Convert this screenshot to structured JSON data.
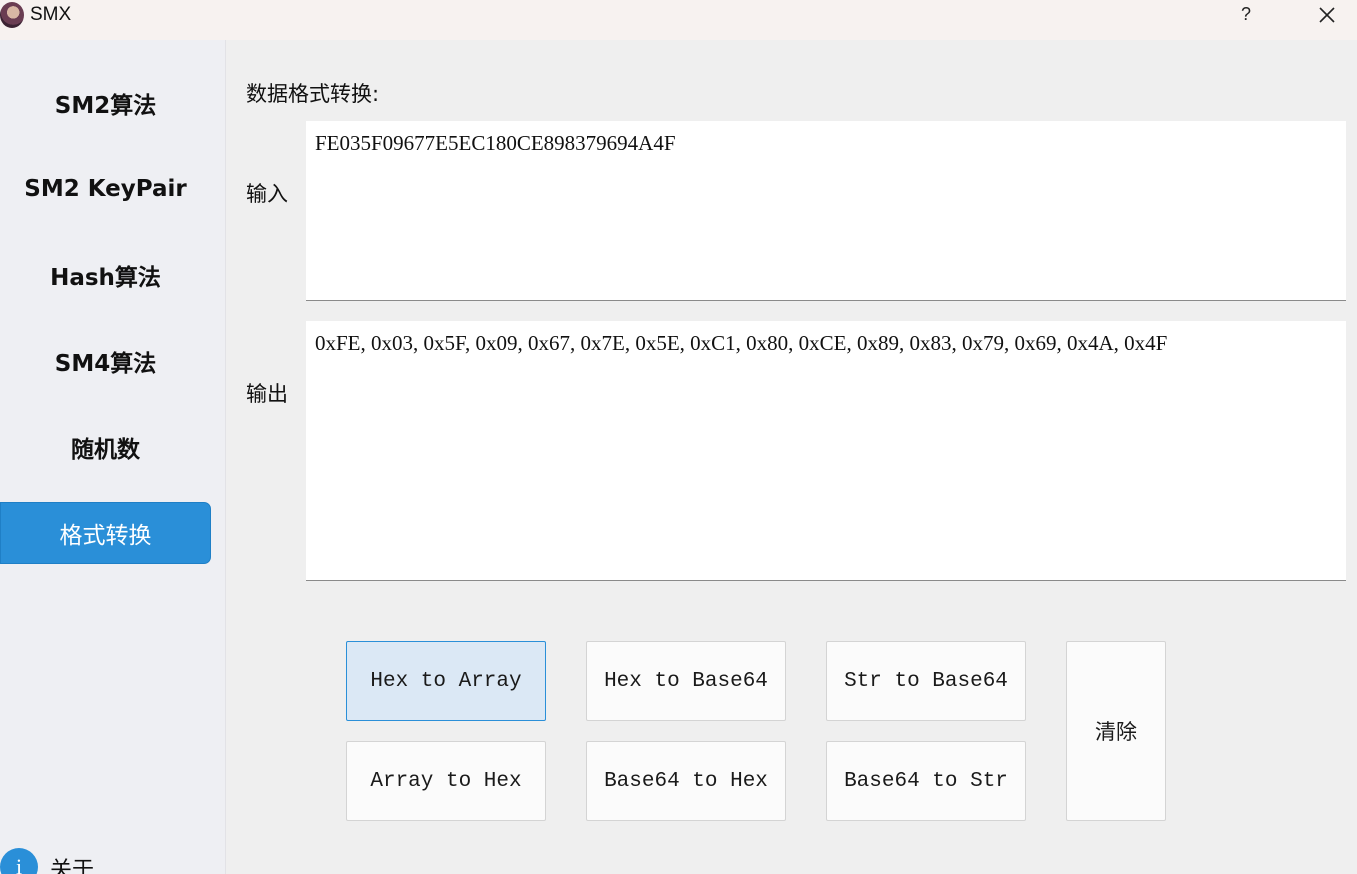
{
  "window": {
    "title": "SMX",
    "help_label": "?",
    "app_icon": "app-logo-icon",
    "close_icon": "close-icon"
  },
  "sidebar": {
    "items": [
      {
        "label": "SM2算法"
      },
      {
        "label": "SM2 KeyPair"
      },
      {
        "label": "Hash算法"
      },
      {
        "label": "SM4算法"
      },
      {
        "label": "随机数"
      },
      {
        "label": "格式转换",
        "active": true
      }
    ],
    "about": {
      "icon_glyph": "i",
      "label": "关于"
    }
  },
  "main": {
    "section_title": "数据格式转换:",
    "input_label": "输入",
    "input_value": "FE035F09677E5EC180CE898379694A4F",
    "output_label": "输出",
    "output_value": "0xFE, 0x03, 0x5F, 0x09, 0x67, 0x7E, 0x5E, 0xC1, 0x80, 0xCE, 0x89, 0x83, 0x79, 0x69, 0x4A, 0x4F",
    "buttons": {
      "hex_to_array": "Hex to Array",
      "hex_to_base64": "Hex to Base64",
      "str_to_base64": "Str to Base64",
      "array_to_hex": "Array to Hex",
      "base64_to_hex": "Base64 to Hex",
      "base64_to_str": "Base64 to Str",
      "clear": "清除"
    }
  },
  "colors": {
    "accent": "#2a8fd8",
    "sidebar_bg": "#eeeff3",
    "content_bg": "#efefef",
    "titlebar_bg": "#f7f2f0"
  }
}
